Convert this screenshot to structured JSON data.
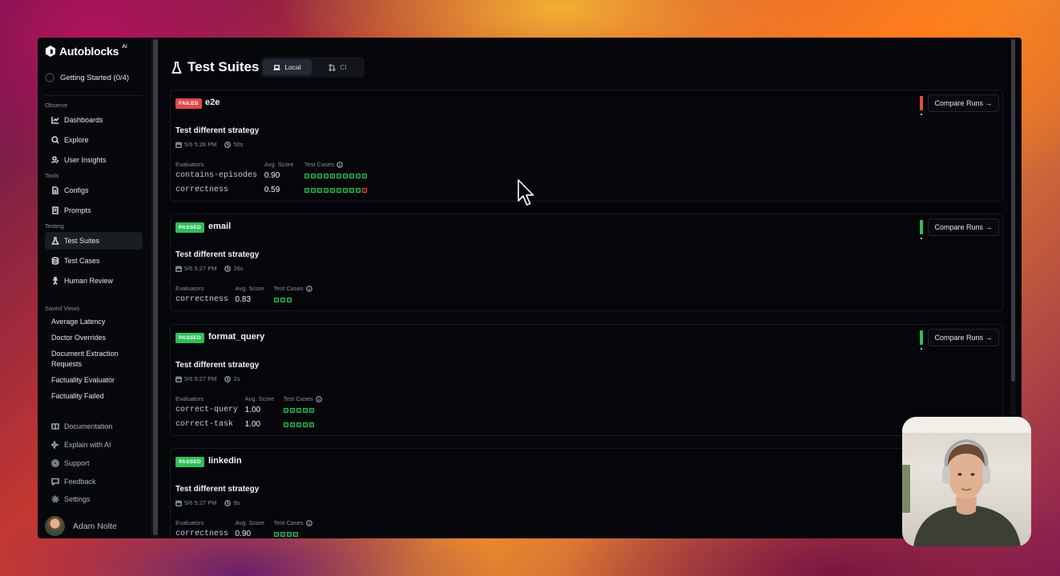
{
  "sidebar": {
    "brand": "Autoblocks",
    "brand_sup": "AI",
    "getting_started": "Getting Started (0/4)",
    "sections": {
      "observe": "Observe",
      "tools": "Tools",
      "testing": "Testing",
      "saved_views": "Saved Views"
    },
    "nav": {
      "dashboards": "Dashboards",
      "explore": "Explore",
      "user_insights": "User Insights",
      "configs": "Configs",
      "prompts": "Prompts",
      "test_suites": "Test Suites",
      "test_cases": "Test Cases",
      "human_review": "Human Review"
    },
    "saved_views": [
      "Average Latency",
      "Doctor Overrides",
      "Document Extraction Requests",
      "Factuality Evaluator",
      "Factuality Failed"
    ],
    "bottom": {
      "documentation": "Documentation",
      "explain": "Explain with AI",
      "support": "Support",
      "feedback": "Feedback",
      "settings": "Settings"
    },
    "user_name": "Adam Nolte"
  },
  "page": {
    "title": "Test Suites",
    "toggle": {
      "local": "Local",
      "ci": "CI",
      "selected": "Local"
    }
  },
  "labels": {
    "evaluators": "Evaluators",
    "avg_score": "Avg. Score",
    "test_cases": "Test Cases",
    "compare_runs": "Compare Runs →"
  },
  "colors": {
    "passed": "#2fbe5a",
    "failed": "#e34848"
  },
  "suites": [
    {
      "status": "FAILED",
      "name": "e2e",
      "run": "Test different strategy",
      "date": "5/6 5:28 PM",
      "duration": "50s",
      "evaluators": [
        {
          "name": "contains-episodes",
          "score": "0.90",
          "cases": [
            "pass",
            "pass",
            "pass",
            "pass",
            "pass",
            "pass",
            "pass",
            "pass",
            "pass",
            "pass"
          ]
        },
        {
          "name": "correctness",
          "score": "0.59",
          "cases": [
            "pass",
            "pass",
            "pass",
            "pass",
            "pass",
            "pass",
            "pass",
            "pass",
            "pass",
            "fail"
          ]
        }
      ]
    },
    {
      "status": "PASSED",
      "name": "email",
      "run": "Test different strategy",
      "date": "5/6 5:27 PM",
      "duration": "26s",
      "evaluators": [
        {
          "name": "correctness",
          "score": "0.83",
          "cases": [
            "pass",
            "pass",
            "pass"
          ]
        }
      ]
    },
    {
      "status": "PASSED",
      "name": "format_query",
      "run": "Test different strategy",
      "date": "5/6 5:27 PM",
      "duration": "2s",
      "evaluators": [
        {
          "name": "correct-query",
          "score": "1.00",
          "cases": [
            "pass",
            "pass",
            "pass",
            "pass",
            "pass"
          ]
        },
        {
          "name": "correct-task",
          "score": "1.00",
          "cases": [
            "pass",
            "pass",
            "pass",
            "pass",
            "pass"
          ]
        }
      ]
    },
    {
      "status": "PASSED",
      "name": "linkedin",
      "run": "Test different strategy",
      "date": "5/6 5:27 PM",
      "duration": "9s",
      "evaluators": [
        {
          "name": "correctness",
          "score": "0.90",
          "cases": [
            "pass",
            "pass",
            "pass",
            "pass"
          ]
        }
      ]
    }
  ]
}
